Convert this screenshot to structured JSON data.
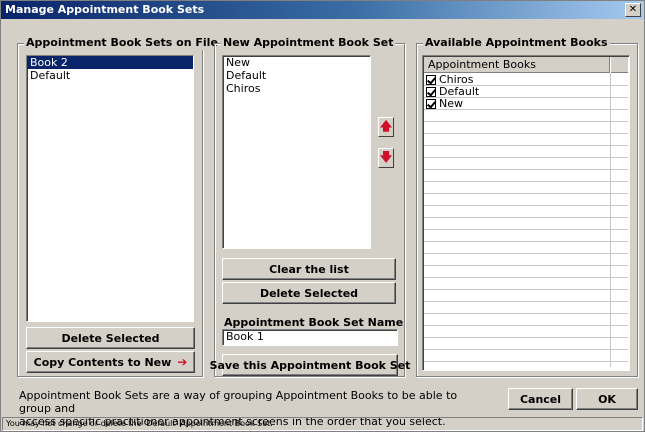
{
  "window": {
    "title": "Manage Appointment Book Sets",
    "close_label": "✕"
  },
  "sets_on_file": {
    "title": "Appointment Book Sets on File",
    "items": [
      {
        "label": "Book 2",
        "selected": true
      },
      {
        "label": "Default",
        "selected": false
      }
    ],
    "delete_label": "Delete Selected",
    "copy_label": "Copy Contents to New"
  },
  "new_set": {
    "title": "New Appointment Book Set",
    "items": [
      "New",
      "Default",
      "Chiros"
    ],
    "clear_label": "Clear the list",
    "delete_label": "Delete Selected",
    "name_label": "Appointment Book Set Name",
    "name_value": "Book 1",
    "save_label": "Save this Appointment Book Set"
  },
  "available": {
    "title": "Available Appointment Books",
    "column_header": "Appointment Books",
    "rows": [
      {
        "label": "Chiros",
        "checked": true
      },
      {
        "label": "Default",
        "checked": true
      },
      {
        "label": "New",
        "checked": true
      }
    ]
  },
  "footer": {
    "info_line1": "Appointment Book Sets are a way of grouping Appointment Books to be able to group and",
    "info_line2": "access specific practitioner appointment screens in the order that you select.",
    "cancel_label": "Cancel",
    "ok_label": "OK",
    "status_text": "You may not change or delete the 'Default' Appointment Book Set."
  },
  "icons": {
    "up_arrow": "arrow-up-icon",
    "down_arrow": "arrow-down-icon",
    "right_arrow": "arrow-right-icon"
  },
  "colors": {
    "title_gradient_start": "#0a246a",
    "selection": "#0a246a",
    "arrow_accent": "#d0102a",
    "dialog_bg": "#d4d0c8"
  }
}
